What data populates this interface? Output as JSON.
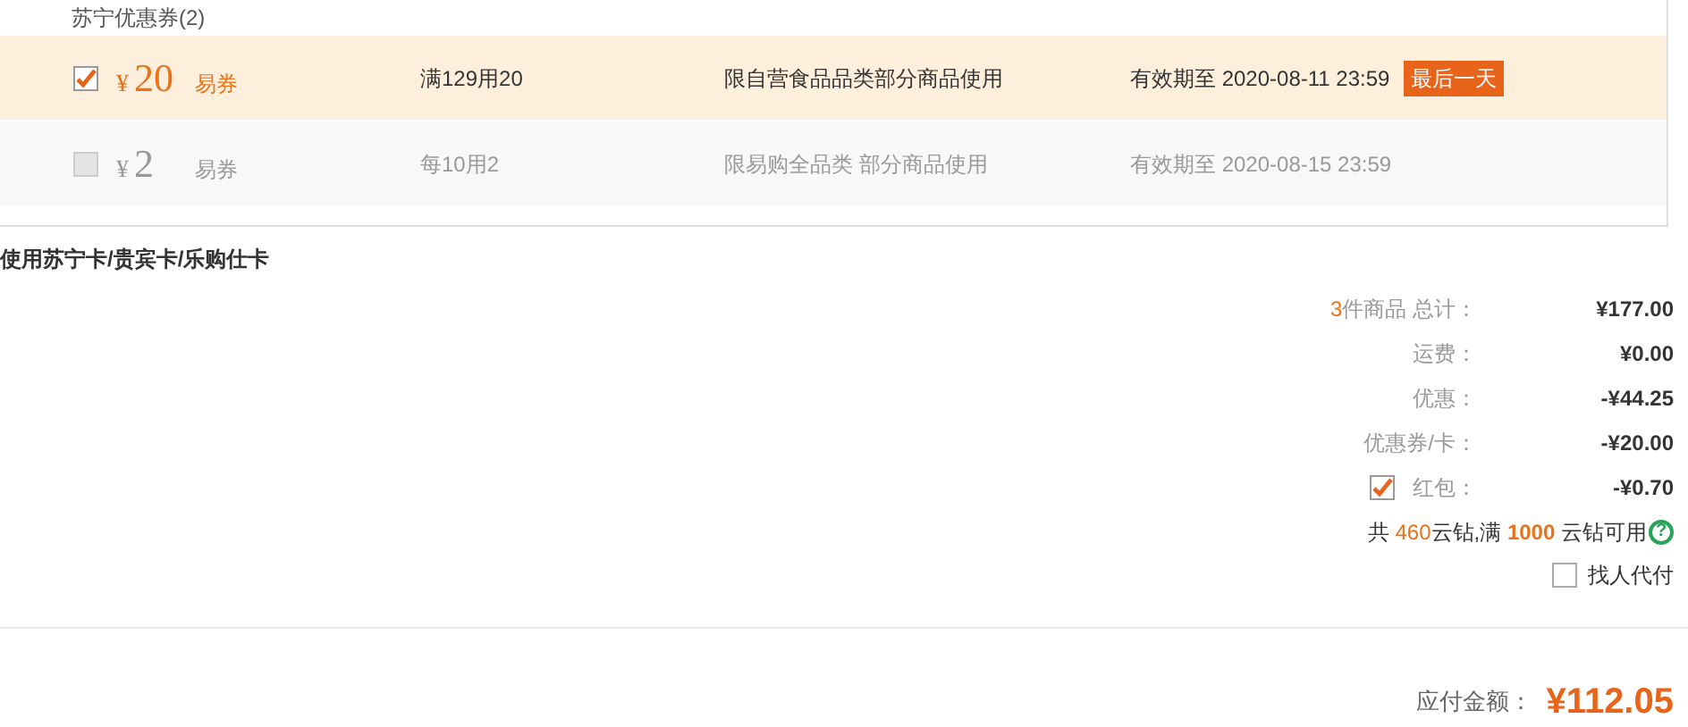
{
  "coupon_section": {
    "title": "苏宁优惠券(2)",
    "coupons": [
      {
        "checked": true,
        "enabled": true,
        "amount": "20",
        "currency": "¥",
        "type": "易券",
        "condition": "满129用20",
        "scope": "限自营食品品类部分商品使用",
        "expiry": "有效期至 2020-08-11 23:59",
        "badge": "最后一天"
      },
      {
        "checked": false,
        "enabled": false,
        "amount": "2",
        "currency": "¥",
        "type": "易券",
        "condition": "每10用2",
        "scope": "限易购全品类 部分商品使用",
        "expiry": "有效期至 2020-08-15 23:59"
      }
    ]
  },
  "card_link": "使用苏宁卡/贵宾卡/乐购仕卡",
  "summary": [
    {
      "kind": "count",
      "count": "3",
      "label": "件商品 总计：",
      "value": "¥177.00"
    },
    {
      "kind": "plain",
      "label": "运费：",
      "value": "¥0.00"
    },
    {
      "kind": "plain",
      "label": "优惠：",
      "value": "-¥44.25"
    },
    {
      "kind": "plain",
      "label": "优惠券/卡：",
      "value": "-¥20.00"
    },
    {
      "kind": "check",
      "checked": true,
      "label": "红包：",
      "value": "-¥0.70"
    }
  ],
  "coins": {
    "prefix": "共 ",
    "owned": "460",
    "middle": "云钻,满 ",
    "threshold": "1000",
    "suffix": " 云钻可用",
    "help": "?"
  },
  "pay_for_me": {
    "checked": false,
    "label": "找人代付"
  },
  "payable": {
    "label": "应付金额：",
    "value": "¥112.05"
  }
}
